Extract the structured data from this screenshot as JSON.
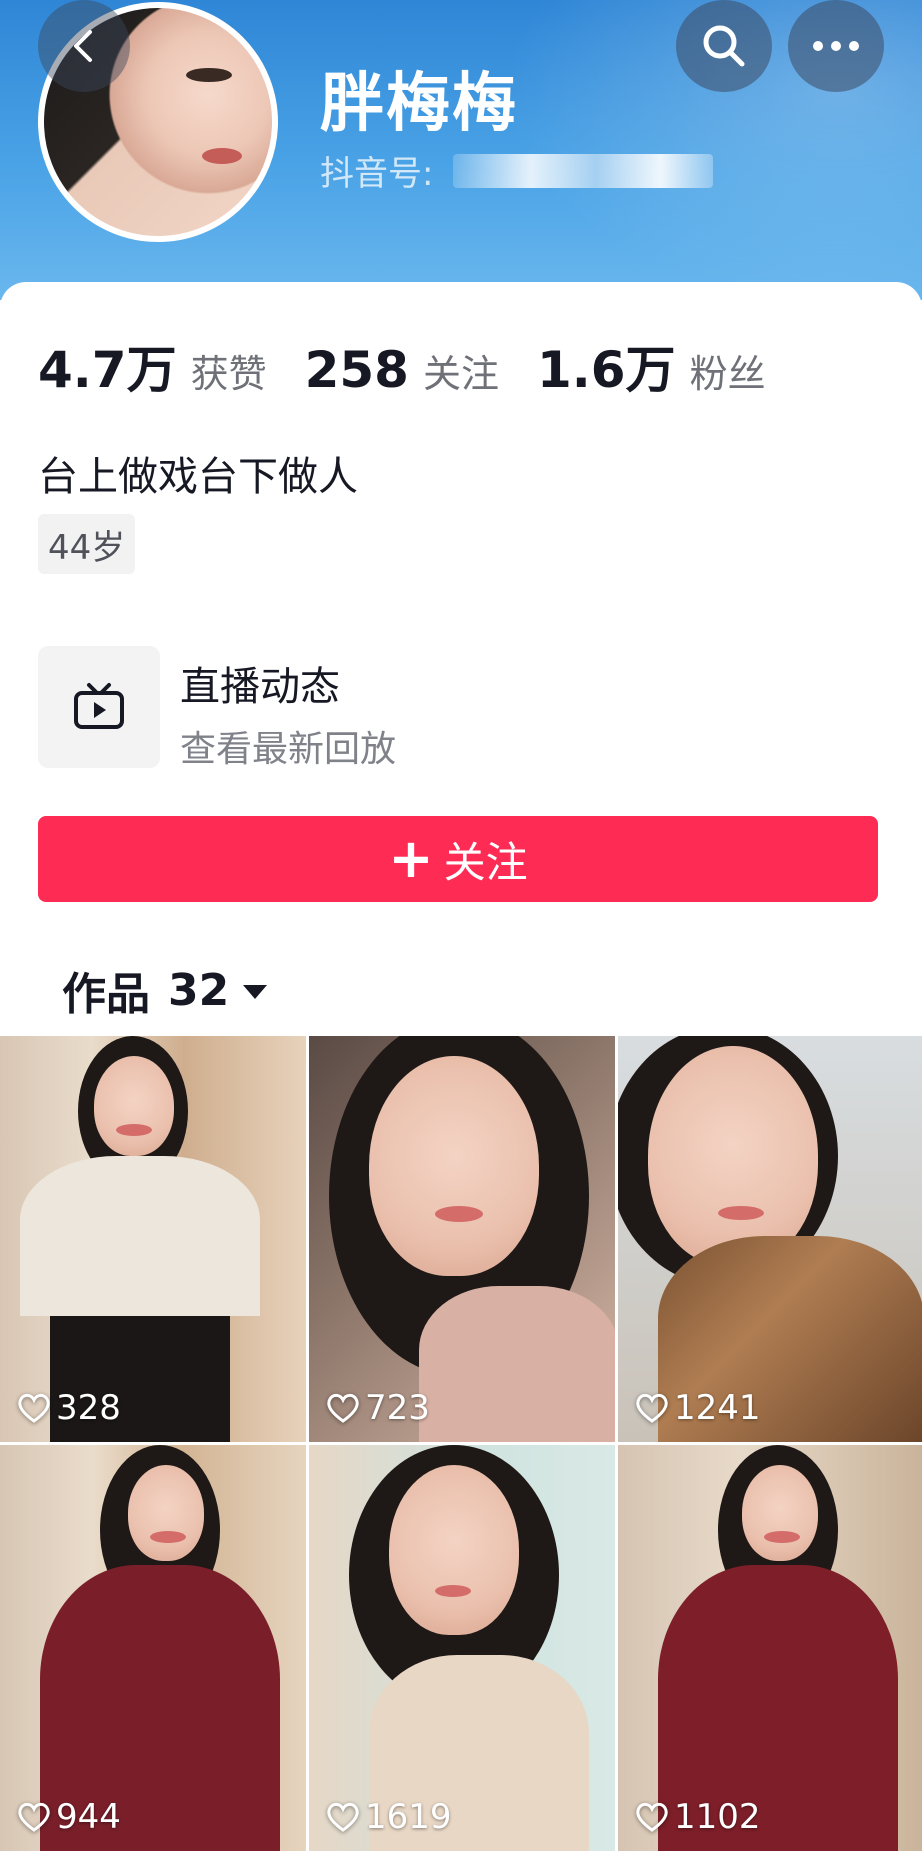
{
  "profile": {
    "name": "胖梅梅",
    "douyin_id_label": "抖音号:",
    "bio": "台上做戏台下做人",
    "age_tag": "44岁"
  },
  "stats": [
    {
      "value": "4.7万",
      "label": "获赞"
    },
    {
      "value": "258",
      "label": "关注"
    },
    {
      "value": "1.6万",
      "label": "粉丝"
    }
  ],
  "live": {
    "title": "直播动态",
    "subtitle": "查看最新回放"
  },
  "follow_button": {
    "label": "关注"
  },
  "works": {
    "label": "作品",
    "count": "32"
  },
  "videos": [
    {
      "likes": "328"
    },
    {
      "likes": "723"
    },
    {
      "likes": "1241"
    },
    {
      "likes": "944"
    },
    {
      "likes": "1619"
    },
    {
      "likes": "1102"
    }
  ],
  "colors": {
    "accent": "#fe2c55",
    "header_blue": "#3a93dd"
  },
  "icons": {
    "back": "chevron-left-icon",
    "search": "search-icon",
    "more": "more-icon",
    "live": "tv-icon",
    "like": "heart-icon"
  }
}
